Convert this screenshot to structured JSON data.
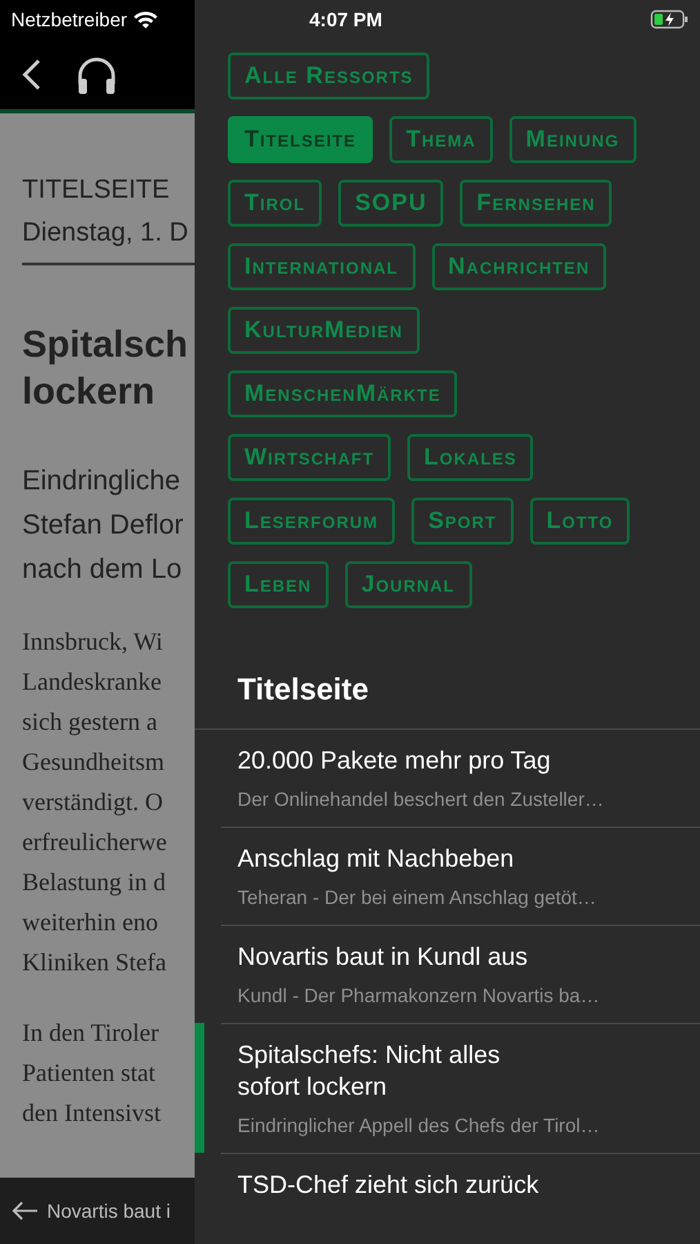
{
  "status_bar": {
    "carrier": "Netzbetreiber",
    "time": "4:07 PM"
  },
  "article": {
    "section": "TITELSEITE",
    "date": "Dienstag, 1. D",
    "headline_lines": [
      "Spitalsch",
      "lockern"
    ],
    "lead_lines": [
      "Eindringliche",
      "Stefan Deflor",
      "nach dem Lo"
    ],
    "body_paragraphs": [
      [
        "Innsbruck, Wi",
        "Landeskranke",
        "sich gestern a",
        "Gesundheitsm",
        "verständigt. O",
        "erfreulicherwe",
        "Belastung in d",
        "weiterhin eno",
        "Kliniken Stefa"
      ],
      [
        "In den Tiroler",
        "Patienten stat",
        "den Intensivst"
      ]
    ],
    "next_link": "Novartis baut i"
  },
  "drawer": {
    "ressort_rows": [
      [
        {
          "label": "Alle Ressorts",
          "selected": false
        }
      ],
      [
        {
          "label": "Titelseite",
          "selected": true
        },
        {
          "label": "Thema",
          "selected": false
        },
        {
          "label": "Meinung",
          "selected": false
        }
      ],
      [
        {
          "label": "Tirol",
          "selected": false
        },
        {
          "label": "SOPU",
          "selected": false
        },
        {
          "label": "Fernsehen",
          "selected": false
        }
      ],
      [
        {
          "label": "International",
          "selected": false
        },
        {
          "label": "Nachrichten",
          "selected": false
        }
      ],
      [
        {
          "label": "KulturMedien",
          "selected": false
        }
      ],
      [
        {
          "label": "MenschenMärkte",
          "selected": false
        }
      ],
      [
        {
          "label": "Wirtschaft",
          "selected": false
        },
        {
          "label": "Lokales",
          "selected": false
        }
      ],
      [
        {
          "label": "Leserforum",
          "selected": false
        },
        {
          "label": "Sport",
          "selected": false
        },
        {
          "label": "Lotto",
          "selected": false
        }
      ],
      [
        {
          "label": "Leben",
          "selected": false
        },
        {
          "label": "Journal",
          "selected": false
        }
      ]
    ],
    "section_title": "Titelseite",
    "articles": [
      {
        "title": "20.000 Pakete mehr pro Tag",
        "teaser": "Der Onlinehandel beschert den Zusteller…",
        "selected": false
      },
      {
        "title": "Anschlag mit Nachbeben",
        "teaser": "Teheran - Der bei einem Anschlag getöt…",
        "selected": false
      },
      {
        "title": "Novartis baut in Kundl aus",
        "teaser": "Kundl - Der Pharmakonzern Novartis ba…",
        "selected": false
      },
      {
        "title": "Spitalschefs: Nicht alles sofort lockern",
        "teaser": "Eindringlicher Appell des Chefs der Tirol…",
        "selected": true
      },
      {
        "title": "TSD-Chef zieht sich zurück",
        "selected": false
      }
    ]
  }
}
